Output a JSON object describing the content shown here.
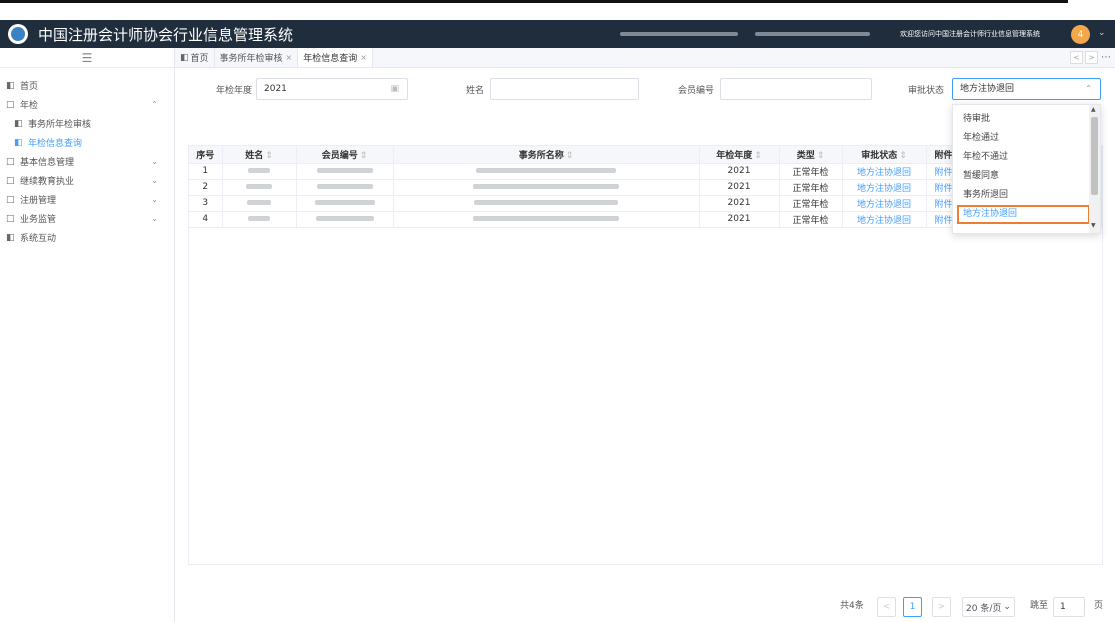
{
  "app": {
    "title": "中国注册会计师协会行业信息管理系统",
    "welcome": "欢迎您访问中国注册会计师行业信息管理系统",
    "user_badge": "4"
  },
  "sidebar": {
    "items": [
      {
        "label": "首页",
        "icon": "doc-icon"
      },
      {
        "label": "年检",
        "icon": "folder-icon",
        "expanded": true
      },
      {
        "label": "事务所年检审核",
        "icon": "doc-icon",
        "sub": true
      },
      {
        "label": "年检信息查询",
        "icon": "doc-icon",
        "sub": true,
        "active": true
      },
      {
        "label": "基本信息管理",
        "icon": "folder-icon"
      },
      {
        "label": "继续教育执业",
        "icon": "folder-icon"
      },
      {
        "label": "注册管理",
        "icon": "folder-icon"
      },
      {
        "label": "业务监管",
        "icon": "folder-icon"
      },
      {
        "label": "系统互动",
        "icon": "doc-icon"
      }
    ]
  },
  "tabs": [
    {
      "label": "首页"
    },
    {
      "label": "事务所年检审核"
    },
    {
      "label": "年检信息查询",
      "active": true
    }
  ],
  "filters": {
    "year_label": "年检年度",
    "year_value": "2021",
    "name_label": "姓名",
    "name_value": "",
    "member_label": "会员编号",
    "member_value": "",
    "status_label": "审批状态",
    "status_value": "地方注协退回"
  },
  "status_options": [
    "待审批",
    "年检通过",
    "年检不通过",
    "暂缓同意",
    "事务所退回",
    "地方注协退回"
  ],
  "table": {
    "columns": [
      "序号",
      "姓名",
      "会员编号",
      "事务所名称",
      "年检年度",
      "类型",
      "审批状态",
      "附件"
    ],
    "rows": [
      {
        "index": "1",
        "year": "2021",
        "type": "正常年检",
        "status": "地方注协退回",
        "attach": "附件"
      },
      {
        "index": "2",
        "year": "2021",
        "type": "正常年检",
        "status": "地方注协退回",
        "attach": "附件"
      },
      {
        "index": "3",
        "year": "2021",
        "type": "正常年检",
        "status": "地方注协退回",
        "attach": "附件"
      },
      {
        "index": "4",
        "year": "2021",
        "type": "正常年检",
        "status": "地方注协退回",
        "attach": "附件"
      }
    ]
  },
  "pagination": {
    "total": "共4条",
    "current_page": "1",
    "page_size": "20 条/页",
    "jump_label": "跳至",
    "jump_value": "1",
    "page_unit": "页"
  },
  "colors": {
    "header_bg": "#1f2d3d",
    "accent": "#409eff",
    "highlight": "#ed7d31",
    "badge": "#f4a64a"
  }
}
